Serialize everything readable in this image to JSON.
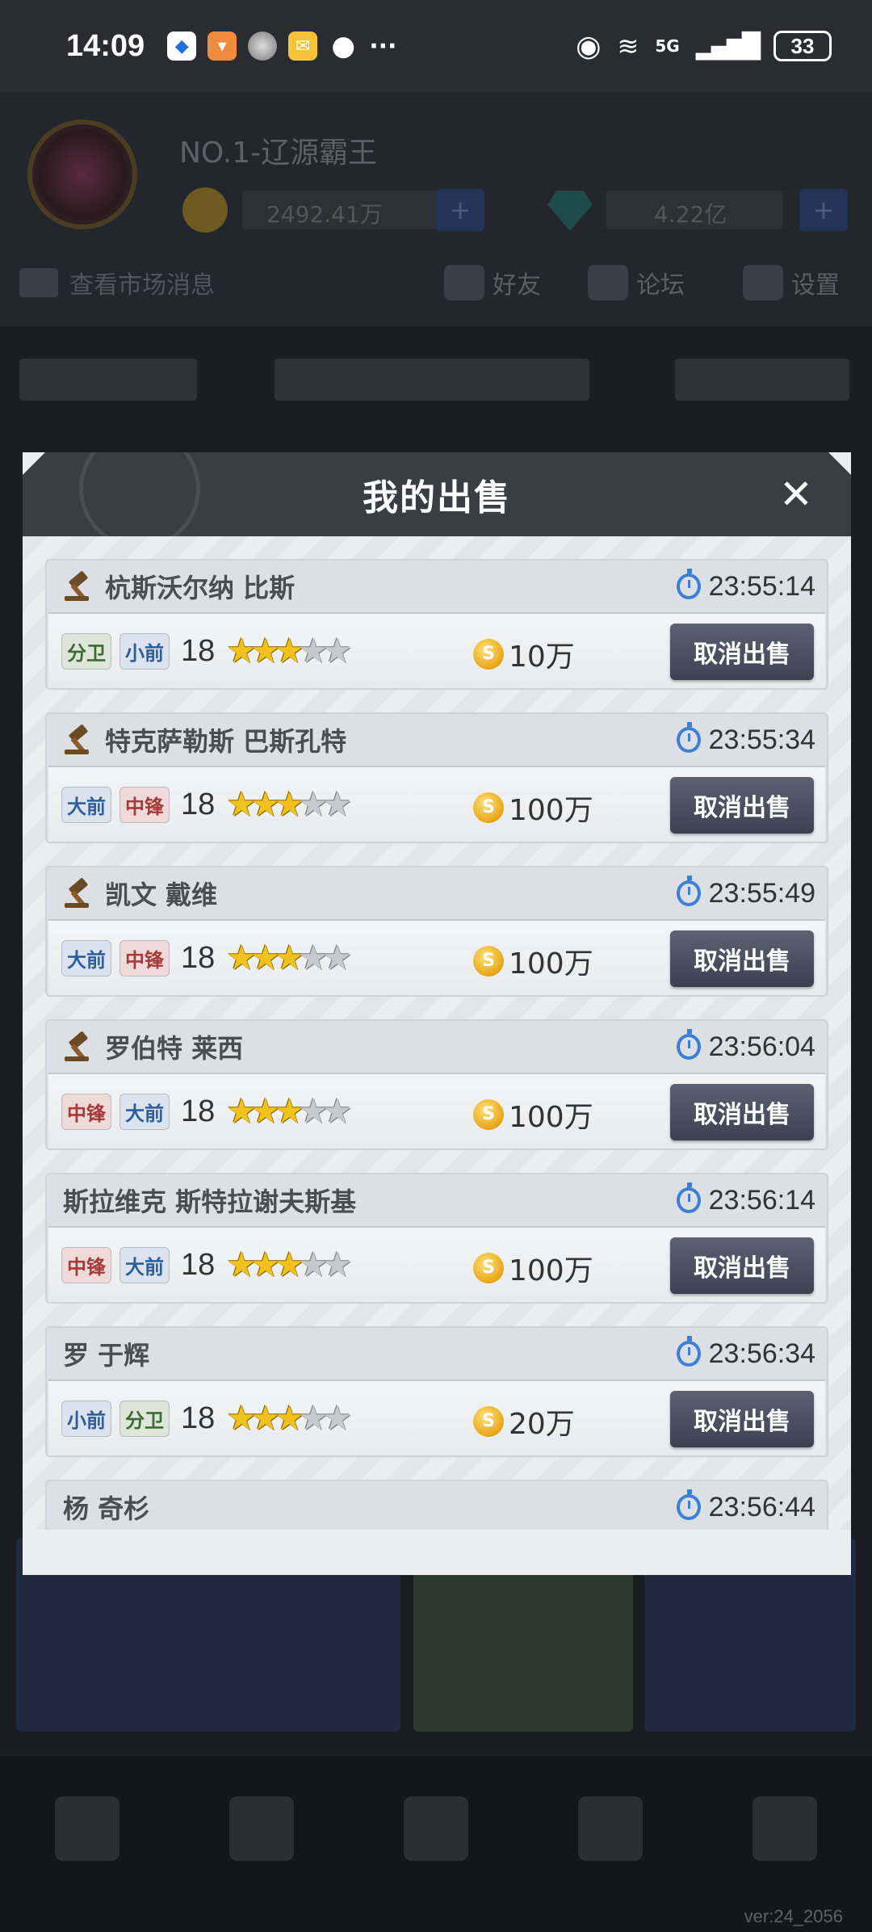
{
  "status_bar": {
    "time": "14:09",
    "network": "5G",
    "battery": "33",
    "more": "···"
  },
  "background": {
    "player_name": "NO.1-辽源霸王",
    "coin_amount": "2492.41万",
    "gem_amount": "4.22亿",
    "market_info": "查看市场消息",
    "menu_items": [
      "好友",
      "论坛",
      "设置"
    ],
    "version": "ver:24_2056"
  },
  "modal": {
    "title": "我的出售",
    "close_label": "✕",
    "cancel_label": "取消出售",
    "items": [
      {
        "name": "杭斯沃尔纳 比斯",
        "auction": true,
        "timer": "23:55:14",
        "positions": [
          {
            "label": "分卫",
            "type": "sg"
          },
          {
            "label": "小前",
            "type": "sf"
          }
        ],
        "level": "18",
        "stars": 3,
        "price": "10万"
      },
      {
        "name": "特克萨勒斯 巴斯孔特",
        "auction": true,
        "timer": "23:55:34",
        "positions": [
          {
            "label": "大前",
            "type": "pf"
          },
          {
            "label": "中锋",
            "type": "c"
          }
        ],
        "level": "18",
        "stars": 3,
        "price": "100万"
      },
      {
        "name": "凯文 戴维",
        "auction": true,
        "timer": "23:55:49",
        "positions": [
          {
            "label": "大前",
            "type": "pf"
          },
          {
            "label": "中锋",
            "type": "c"
          }
        ],
        "level": "18",
        "stars": 3,
        "price": "100万"
      },
      {
        "name": "罗伯特 莱西",
        "auction": true,
        "timer": "23:56:04",
        "positions": [
          {
            "label": "中锋",
            "type": "c"
          },
          {
            "label": "大前",
            "type": "pf"
          }
        ],
        "level": "18",
        "stars": 3,
        "price": "100万"
      },
      {
        "name": "斯拉维克 斯特拉谢夫斯基",
        "auction": false,
        "timer": "23:56:14",
        "positions": [
          {
            "label": "中锋",
            "type": "c"
          },
          {
            "label": "大前",
            "type": "pf"
          }
        ],
        "level": "18",
        "stars": 3,
        "price": "100万"
      },
      {
        "name": "罗 于辉",
        "auction": false,
        "timer": "23:56:34",
        "positions": [
          {
            "label": "小前",
            "type": "sf"
          },
          {
            "label": "分卫",
            "type": "sg"
          }
        ],
        "level": "18",
        "stars": 3,
        "price": "20万"
      },
      {
        "name": "杨 奇杉",
        "auction": false,
        "timer": "23:56:44",
        "positions": [],
        "level": "",
        "stars": 0,
        "price": ""
      }
    ]
  },
  "colors": {
    "header_bg": "#3a3d42",
    "button_bg": "#4a4e5e",
    "timer_blue": "#3d7fd6",
    "star_gold": "#f2c21c"
  }
}
